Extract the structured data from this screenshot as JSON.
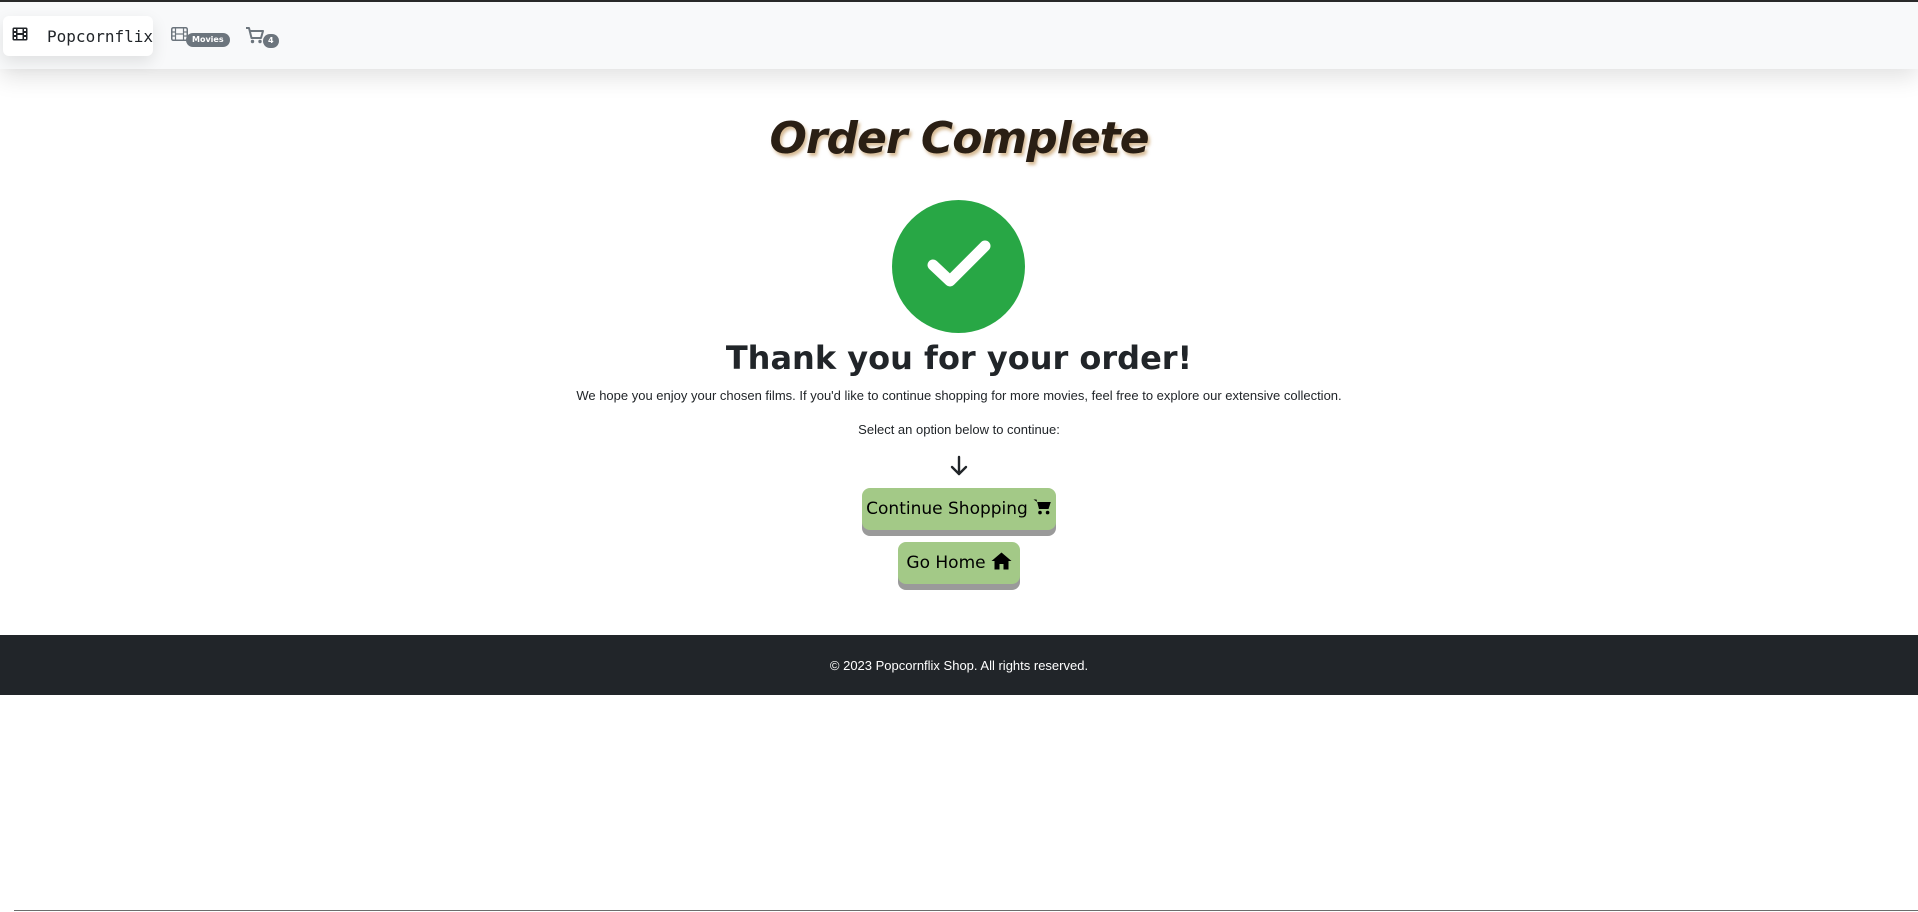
{
  "navbar": {
    "brand": "Popcornflix",
    "movies_badge": "Movies",
    "cart_count": "4"
  },
  "main": {
    "title": "Order Complete",
    "thanks": "Thank you for your order!",
    "message": "We hope you enjoy your chosen films. If you'd like to continue shopping for more movies, feel free to explore our extensive collection.",
    "prompt": "Select an option below to continue:",
    "continue_button": "Continue Shopping",
    "home_button": "Go Home"
  },
  "footer": {
    "text": "© 2023 Popcornflix Shop. All rights reserved."
  },
  "colors": {
    "success": "#28a745",
    "button_bg": "#a3c987",
    "footer_bg": "#212529",
    "badge_bg": "#6c757d"
  },
  "icons": [
    "film-icon",
    "cart-icon",
    "check-icon",
    "arrow-down-icon",
    "home-icon"
  ]
}
